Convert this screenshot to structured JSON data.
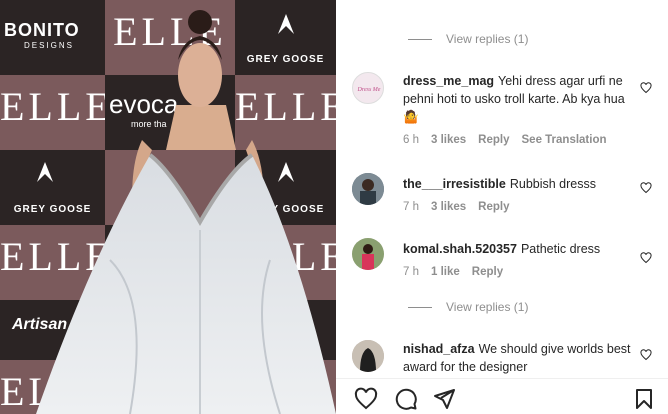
{
  "media": {
    "backdrop": {
      "elle_text": "ELLE",
      "goose_text": "GREY GOOSE",
      "bonito_text": "BONITO",
      "bonito_sub": "DESIGNS",
      "evoc_text": "evoca",
      "evoc_sub": "more tha",
      "artisan_text": "Artisan"
    }
  },
  "comments": {
    "top_view_replies": "View replies (1)",
    "items": [
      {
        "username": "dress_me_mag",
        "text": "Yehi dress agar urfi ne pehni hoti to usko troll karte. Ab kya hua 🤷",
        "time": "6 h",
        "likes": "3 likes",
        "reply": "Reply",
        "translate": "See Translation",
        "avatar_text": "Dress Me"
      },
      {
        "username": "the___irresistible",
        "text": "Rubbish dresss",
        "time": "7 h",
        "likes": "3 likes",
        "reply": "Reply"
      },
      {
        "username": "komal.shah.520357",
        "text": "Pathetic dress",
        "time": "7 h",
        "likes": "1 like",
        "reply": "Reply"
      },
      {
        "username": "nishad_afza",
        "text": "We should give worlds best award for the designer",
        "time": "",
        "likes": "",
        "reply": ""
      }
    ],
    "mid_view_replies": "View replies (1)"
  },
  "actions": {
    "icons": [
      "heart-icon",
      "comment-icon",
      "share-icon",
      "bookmark-icon"
    ]
  },
  "colors": {
    "username": "#262626",
    "meta": "#8e8e8e",
    "backdrop_rose": "#7b5a5c",
    "backdrop_dark": "#2b2424"
  }
}
